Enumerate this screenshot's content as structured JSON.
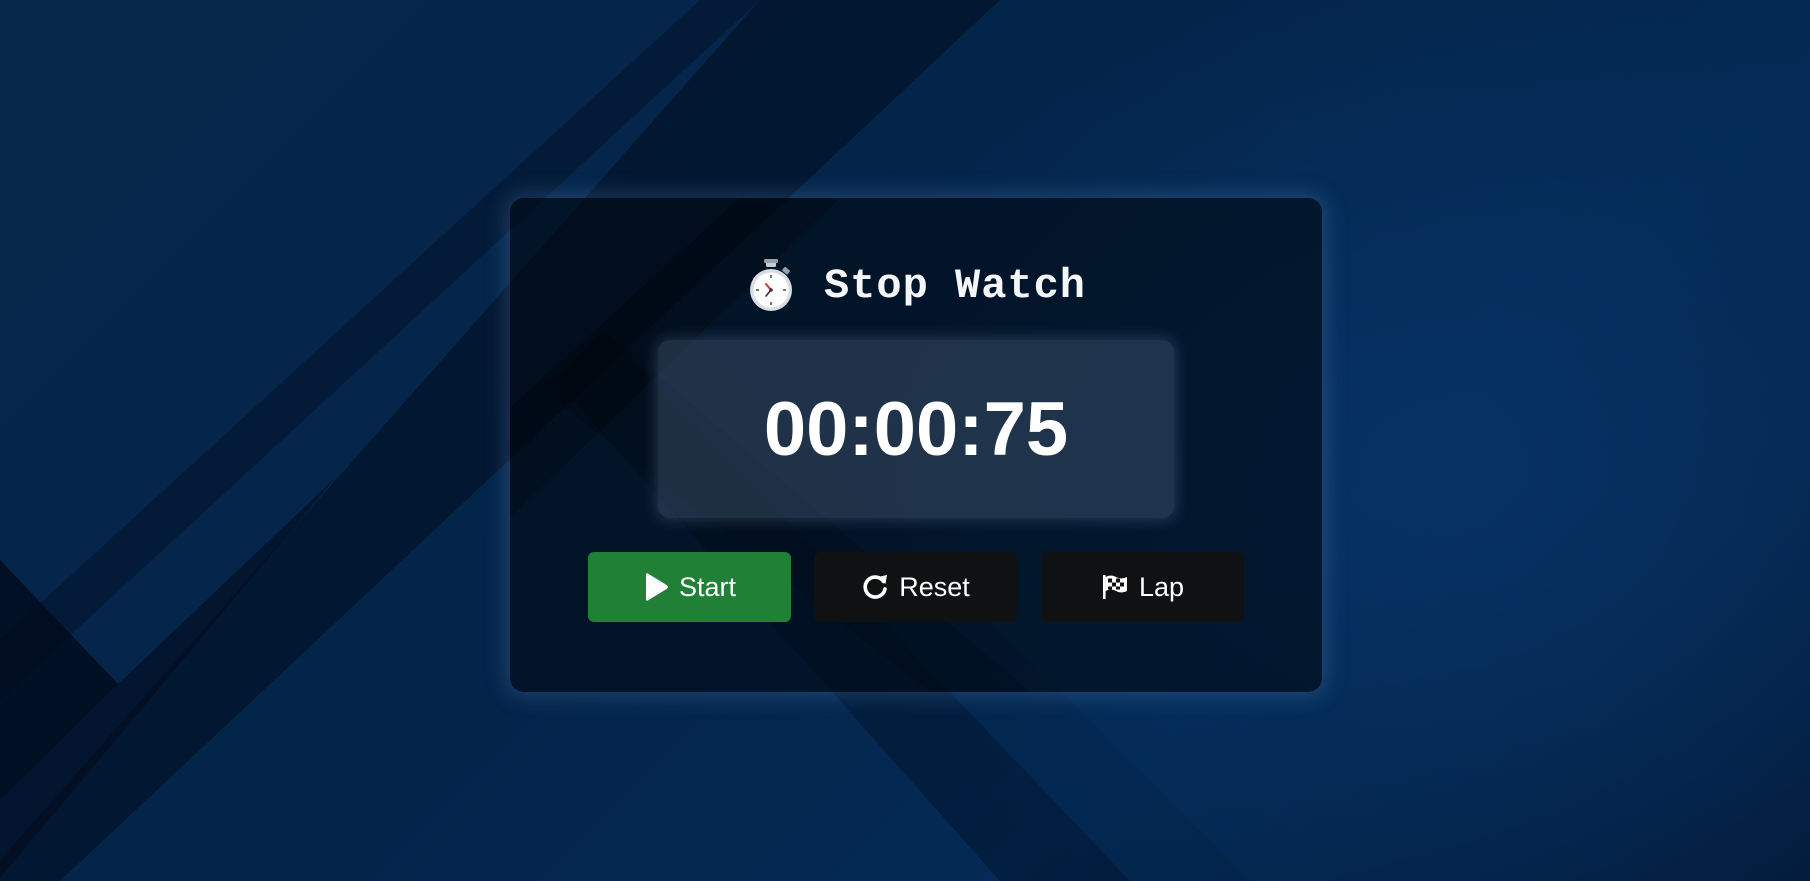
{
  "app": {
    "title": "Stop Watch",
    "title_icon": "stopwatch-icon"
  },
  "display": {
    "time": "00:00:75"
  },
  "buttons": {
    "start": {
      "label": "Start",
      "icon": "play-icon",
      "color": "#1f8036"
    },
    "reset": {
      "label": "Reset",
      "icon": "reset-icon",
      "color": "#101112"
    },
    "lap": {
      "label": "Lap",
      "icon": "checkered-flag-icon",
      "color": "#101112"
    }
  },
  "colors": {
    "background": "#04254a",
    "card": "#020b16",
    "accent_green": "#1f8036"
  }
}
